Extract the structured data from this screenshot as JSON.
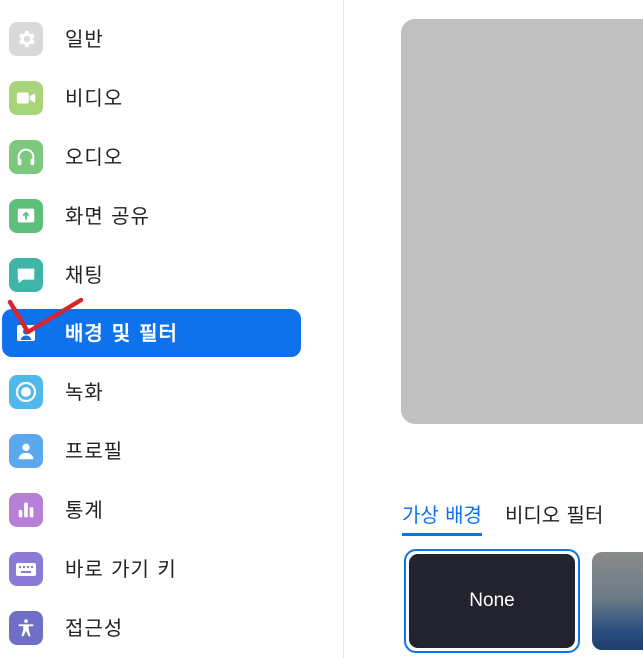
{
  "sidebar": {
    "items": [
      {
        "label": "일반",
        "icon": "gear-icon",
        "color": "#d9d9d9"
      },
      {
        "label": "비디오",
        "icon": "video-camera-icon",
        "color": "#a8d57a"
      },
      {
        "label": "오디오",
        "icon": "headphones-icon",
        "color": "#7cc97e"
      },
      {
        "label": "화면 공유",
        "icon": "share-screen-icon",
        "color": "#5dbf79"
      },
      {
        "label": "채팅",
        "icon": "chat-bubble-icon",
        "color": "#3fb5a7"
      },
      {
        "label": "배경 및 필터",
        "icon": "person-portrait-icon",
        "color": "#0e72ed",
        "active": true
      },
      {
        "label": "녹화",
        "icon": "record-icon",
        "color": "#50b8ea"
      },
      {
        "label": "프로필",
        "icon": "person-icon",
        "color": "#5ba8ee"
      },
      {
        "label": "통계",
        "icon": "bar-chart-icon",
        "color": "#b77fd6"
      },
      {
        "label": "바로 가기 키",
        "icon": "keyboard-icon",
        "color": "#8b7ad6"
      },
      {
        "label": "접근성",
        "icon": "accessibility-icon",
        "color": "#6f6fc7"
      }
    ]
  },
  "main": {
    "tabs": [
      {
        "label": "가상 배경",
        "active": true
      },
      {
        "label": "비디오 필터",
        "active": false
      }
    ],
    "backgrounds": [
      {
        "label": "None",
        "selected": true
      }
    ]
  },
  "colors": {
    "accent": "#0e72ed",
    "annotation": "#d8242f"
  }
}
